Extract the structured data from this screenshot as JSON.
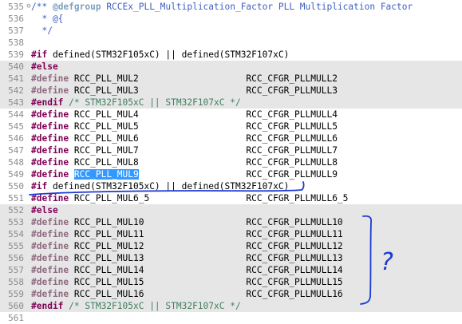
{
  "editor": {
    "selection_text": "RCC_PLL_MUL9",
    "question_mark": "?",
    "lines": [
      {
        "num": "535",
        "fold": "⊖",
        "inactive": false,
        "tokens": [
          {
            "t": "/** ",
            "c": "cmt doc"
          },
          {
            "t": "@defgroup",
            "c": "tag"
          },
          {
            "t": " RCCEx_PLL_Multiplication_Factor PLL Multiplication Factor",
            "c": "cmt doc"
          }
        ]
      },
      {
        "num": "536",
        "fold": "",
        "inactive": false,
        "tokens": [
          {
            "t": "  * @{",
            "c": "cmt doc"
          }
        ]
      },
      {
        "num": "537",
        "fold": "",
        "inactive": false,
        "tokens": [
          {
            "t": "  */",
            "c": "cmt doc"
          }
        ]
      },
      {
        "num": "538",
        "fold": "",
        "inactive": false,
        "tokens": []
      },
      {
        "num": "539",
        "fold": "",
        "inactive": false,
        "tokens": [
          {
            "t": "#if",
            "c": "kw"
          },
          {
            "t": " defined(STM32F105xC) || defined(STM32F107xC)",
            "c": ""
          }
        ]
      },
      {
        "num": "540",
        "fold": "",
        "inactive": true,
        "tokens": [
          {
            "t": "#else",
            "c": "kw"
          }
        ]
      },
      {
        "num": "541",
        "fold": "",
        "inactive": true,
        "tokens": [
          {
            "t": "#define",
            "c": "kw dim"
          },
          {
            "t": " RCC_PLL_MUL2                    RCC_CFGR_PLLMULL2",
            "c": ""
          }
        ]
      },
      {
        "num": "542",
        "fold": "",
        "inactive": true,
        "tokens": [
          {
            "t": "#define",
            "c": "kw dim"
          },
          {
            "t": " RCC_PLL_MUL3                    RCC_CFGR_PLLMULL3",
            "c": ""
          }
        ]
      },
      {
        "num": "543",
        "fold": "",
        "inactive": true,
        "tokens": [
          {
            "t": "#endif",
            "c": "kw"
          },
          {
            "t": " /* STM32F105xC || STM32F107xC */",
            "c": "cmt"
          }
        ]
      },
      {
        "num": "544",
        "fold": "",
        "inactive": false,
        "tokens": [
          {
            "t": "#define",
            "c": "kw"
          },
          {
            "t": " RCC_PLL_MUL4                    RCC_CFGR_PLLMULL4",
            "c": ""
          }
        ]
      },
      {
        "num": "545",
        "fold": "",
        "inactive": false,
        "tokens": [
          {
            "t": "#define",
            "c": "kw"
          },
          {
            "t": " RCC_PLL_MUL5                    RCC_CFGR_PLLMULL5",
            "c": ""
          }
        ]
      },
      {
        "num": "546",
        "fold": "",
        "inactive": false,
        "tokens": [
          {
            "t": "#define",
            "c": "kw"
          },
          {
            "t": " RCC_PLL_MUL6                    RCC_CFGR_PLLMULL6",
            "c": ""
          }
        ]
      },
      {
        "num": "547",
        "fold": "",
        "inactive": false,
        "tokens": [
          {
            "t": "#define",
            "c": "kw"
          },
          {
            "t": " RCC_PLL_MUL7                    RCC_CFGR_PLLMULL7",
            "c": ""
          }
        ]
      },
      {
        "num": "548",
        "fold": "",
        "inactive": false,
        "tokens": [
          {
            "t": "#define",
            "c": "kw"
          },
          {
            "t": " RCC_PLL_MUL8                    RCC_CFGR_PLLMULL8",
            "c": ""
          }
        ]
      },
      {
        "num": "549",
        "fold": "",
        "inactive": false,
        "tokens": [
          {
            "t": "#define",
            "c": "kw"
          },
          {
            "t": " ",
            "c": ""
          },
          {
            "t": "RCC_PLL_MUL9",
            "c": "sel"
          },
          {
            "t": "                    RCC_CFGR_PLLMULL9",
            "c": ""
          }
        ]
      },
      {
        "num": "550",
        "fold": "",
        "inactive": false,
        "tokens": [
          {
            "t": "#if",
            "c": "kw"
          },
          {
            "t": " defined(STM32F105xC) || defined(STM32F107xC)",
            "c": ""
          }
        ]
      },
      {
        "num": "551",
        "fold": "",
        "inactive": false,
        "tokens": [
          {
            "t": "#define",
            "c": "kw"
          },
          {
            "t": " RCC_PLL_MUL6_5                  RCC_CFGR_PLLMULL6_5",
            "c": ""
          }
        ]
      },
      {
        "num": "552",
        "fold": "",
        "inactive": true,
        "tokens": [
          {
            "t": "#else",
            "c": "kw"
          }
        ]
      },
      {
        "num": "553",
        "fold": "",
        "inactive": true,
        "tokens": [
          {
            "t": "#define",
            "c": "kw dim"
          },
          {
            "t": " RCC_PLL_MUL10                   RCC_CFGR_PLLMULL10",
            "c": ""
          }
        ]
      },
      {
        "num": "554",
        "fold": "",
        "inactive": true,
        "tokens": [
          {
            "t": "#define",
            "c": "kw dim"
          },
          {
            "t": " RCC_PLL_MUL11                   RCC_CFGR_PLLMULL11",
            "c": ""
          }
        ]
      },
      {
        "num": "555",
        "fold": "",
        "inactive": true,
        "tokens": [
          {
            "t": "#define",
            "c": "kw dim"
          },
          {
            "t": " RCC_PLL_MUL12                   RCC_CFGR_PLLMULL12",
            "c": ""
          }
        ]
      },
      {
        "num": "556",
        "fold": "",
        "inactive": true,
        "tokens": [
          {
            "t": "#define",
            "c": "kw dim"
          },
          {
            "t": " RCC_PLL_MUL13                   RCC_CFGR_PLLMULL13",
            "c": ""
          }
        ]
      },
      {
        "num": "557",
        "fold": "",
        "inactive": true,
        "tokens": [
          {
            "t": "#define",
            "c": "kw dim"
          },
          {
            "t": " RCC_PLL_MUL14                   RCC_CFGR_PLLMULL14",
            "c": ""
          }
        ]
      },
      {
        "num": "558",
        "fold": "",
        "inactive": true,
        "tokens": [
          {
            "t": "#define",
            "c": "kw dim"
          },
          {
            "t": " RCC_PLL_MUL15                   RCC_CFGR_PLLMULL15",
            "c": ""
          }
        ]
      },
      {
        "num": "559",
        "fold": "",
        "inactive": true,
        "tokens": [
          {
            "t": "#define",
            "c": "kw dim"
          },
          {
            "t": " RCC_PLL_MUL16                   RCC_CFGR_PLLMULL16",
            "c": ""
          }
        ]
      },
      {
        "num": "560",
        "fold": "",
        "inactive": true,
        "tokens": [
          {
            "t": "#endif",
            "c": "kw"
          },
          {
            "t": " /* STM32F105xC || STM32F107xC */",
            "c": "cmt"
          }
        ]
      },
      {
        "num": "561",
        "fold": "",
        "inactive": false,
        "tokens": []
      }
    ]
  },
  "colors": {
    "keyword": "#7f0055",
    "comment": "#3f7f5f",
    "javadoc": "#3f5fbf",
    "selection": "#3399ff",
    "inactive_bg": "#e6e6e6",
    "annotation_ink": "#1a3ad6"
  }
}
